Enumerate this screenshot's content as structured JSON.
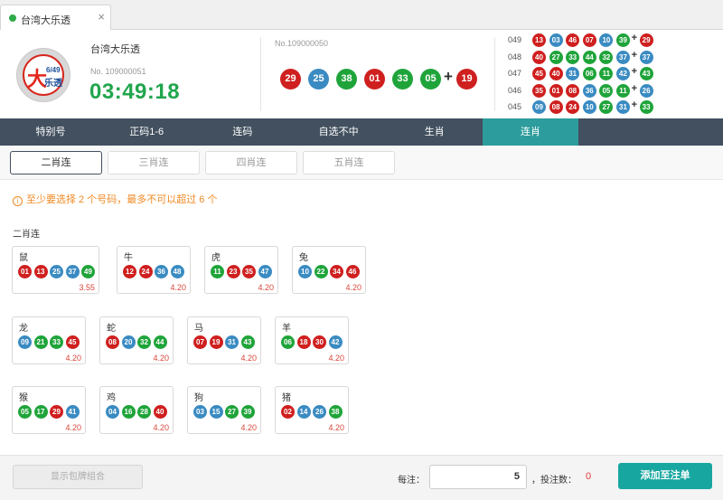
{
  "colors": {
    "red": "#cf1f1f",
    "blue": "#3a8bc2",
    "green": "#1fa43a",
    "accent": "#2d9c9c",
    "nav_bg": "#42505f"
  },
  "tab": {
    "title": "台湾大乐透",
    "close": "×"
  },
  "header": {
    "game_name": "台湾大乐透",
    "issue_label": "No. 109000051",
    "countdown": "03:49:18",
    "logo_big": "大",
    "logo_sm": "6/49",
    "logo_sm2": "乐透",
    "last_issue_label": "No.109000050",
    "last_draw": {
      "balls": [
        {
          "n": "29",
          "c": "red"
        },
        {
          "n": "25",
          "c": "blue"
        },
        {
          "n": "38",
          "c": "green"
        },
        {
          "n": "01",
          "c": "red"
        },
        {
          "n": "33",
          "c": "green"
        },
        {
          "n": "05",
          "c": "green"
        }
      ],
      "special": {
        "n": "19",
        "c": "red"
      }
    },
    "history": [
      {
        "issue": "049",
        "balls": [
          {
            "n": "13",
            "c": "red"
          },
          {
            "n": "03",
            "c": "blue"
          },
          {
            "n": "46",
            "c": "red"
          },
          {
            "n": "07",
            "c": "red"
          },
          {
            "n": "10",
            "c": "blue"
          },
          {
            "n": "39",
            "c": "green"
          }
        ],
        "special": {
          "n": "29",
          "c": "red"
        }
      },
      {
        "issue": "048",
        "balls": [
          {
            "n": "40",
            "c": "red"
          },
          {
            "n": "27",
            "c": "green"
          },
          {
            "n": "33",
            "c": "green"
          },
          {
            "n": "44",
            "c": "green"
          },
          {
            "n": "32",
            "c": "green"
          },
          {
            "n": "37",
            "c": "blue"
          }
        ],
        "special": {
          "n": "37",
          "c": "blue"
        }
      },
      {
        "issue": "047",
        "balls": [
          {
            "n": "45",
            "c": "red"
          },
          {
            "n": "40",
            "c": "red"
          },
          {
            "n": "31",
            "c": "blue"
          },
          {
            "n": "06",
            "c": "green"
          },
          {
            "n": "11",
            "c": "green"
          },
          {
            "n": "42",
            "c": "blue"
          }
        ],
        "special": {
          "n": "43",
          "c": "green"
        }
      },
      {
        "issue": "046",
        "balls": [
          {
            "n": "35",
            "c": "red"
          },
          {
            "n": "01",
            "c": "red"
          },
          {
            "n": "08",
            "c": "red"
          },
          {
            "n": "36",
            "c": "blue"
          },
          {
            "n": "05",
            "c": "green"
          },
          {
            "n": "11",
            "c": "green"
          }
        ],
        "special": {
          "n": "26",
          "c": "blue"
        }
      },
      {
        "issue": "045",
        "balls": [
          {
            "n": "09",
            "c": "blue"
          },
          {
            "n": "08",
            "c": "red"
          },
          {
            "n": "24",
            "c": "red"
          },
          {
            "n": "10",
            "c": "blue"
          },
          {
            "n": "27",
            "c": "green"
          },
          {
            "n": "31",
            "c": "blue"
          }
        ],
        "special": {
          "n": "33",
          "c": "green"
        }
      }
    ],
    "plus": "+"
  },
  "nav": {
    "items": [
      {
        "label": "特别号",
        "active": false
      },
      {
        "label": "正码1-6",
        "active": false
      },
      {
        "label": "连码",
        "active": false
      },
      {
        "label": "自选不中",
        "active": false
      },
      {
        "label": "生肖",
        "active": false
      },
      {
        "label": "连肖",
        "active": true
      }
    ]
  },
  "subtabs": {
    "items": [
      {
        "label": "二肖连",
        "active": true
      },
      {
        "label": "三肖连",
        "active": false
      },
      {
        "label": "四肖连",
        "active": false
      },
      {
        "label": "五肖连",
        "active": false
      }
    ]
  },
  "notice": {
    "icon": "i",
    "text": "至少要选择 2 个号码，最多不可以超过 6 个"
  },
  "section_title": "二肖连",
  "zodiacs": [
    {
      "name": "鼠",
      "odds": "3.55",
      "balls": [
        {
          "n": "01",
          "c": "red"
        },
        {
          "n": "13",
          "c": "red"
        },
        {
          "n": "25",
          "c": "blue"
        },
        {
          "n": "37",
          "c": "blue"
        },
        {
          "n": "49",
          "c": "green"
        }
      ]
    },
    {
      "name": "牛",
      "odds": "4.20",
      "balls": [
        {
          "n": "12",
          "c": "red"
        },
        {
          "n": "24",
          "c": "red"
        },
        {
          "n": "36",
          "c": "blue"
        },
        {
          "n": "48",
          "c": "blue"
        }
      ]
    },
    {
      "name": "虎",
      "odds": "4.20",
      "balls": [
        {
          "n": "11",
          "c": "green"
        },
        {
          "n": "23",
          "c": "red"
        },
        {
          "n": "35",
          "c": "red"
        },
        {
          "n": "47",
          "c": "blue"
        }
      ]
    },
    {
      "name": "兔",
      "odds": "4.20",
      "balls": [
        {
          "n": "10",
          "c": "blue"
        },
        {
          "n": "22",
          "c": "green"
        },
        {
          "n": "34",
          "c": "red"
        },
        {
          "n": "46",
          "c": "red"
        }
      ]
    },
    {
      "name": "龙",
      "odds": "4.20",
      "balls": [
        {
          "n": "09",
          "c": "blue"
        },
        {
          "n": "21",
          "c": "green"
        },
        {
          "n": "33",
          "c": "green"
        },
        {
          "n": "45",
          "c": "red"
        }
      ]
    },
    {
      "name": "蛇",
      "odds": "4.20",
      "balls": [
        {
          "n": "08",
          "c": "red"
        },
        {
          "n": "20",
          "c": "blue"
        },
        {
          "n": "32",
          "c": "green"
        },
        {
          "n": "44",
          "c": "green"
        }
      ]
    },
    {
      "name": "马",
      "odds": "4.20",
      "balls": [
        {
          "n": "07",
          "c": "red"
        },
        {
          "n": "19",
          "c": "red"
        },
        {
          "n": "31",
          "c": "blue"
        },
        {
          "n": "43",
          "c": "green"
        }
      ]
    },
    {
      "name": "羊",
      "odds": "4.20",
      "balls": [
        {
          "n": "06",
          "c": "green"
        },
        {
          "n": "18",
          "c": "red"
        },
        {
          "n": "30",
          "c": "red"
        },
        {
          "n": "42",
          "c": "blue"
        }
      ]
    },
    {
      "name": "猴",
      "odds": "4.20",
      "balls": [
        {
          "n": "05",
          "c": "green"
        },
        {
          "n": "17",
          "c": "green"
        },
        {
          "n": "29",
          "c": "red"
        },
        {
          "n": "41",
          "c": "blue"
        }
      ]
    },
    {
      "name": "鸡",
      "odds": "4.20",
      "balls": [
        {
          "n": "04",
          "c": "blue"
        },
        {
          "n": "16",
          "c": "green"
        },
        {
          "n": "28",
          "c": "green"
        },
        {
          "n": "40",
          "c": "red"
        }
      ]
    },
    {
      "name": "狗",
      "odds": "4.20",
      "balls": [
        {
          "n": "03",
          "c": "blue"
        },
        {
          "n": "15",
          "c": "blue"
        },
        {
          "n": "27",
          "c": "green"
        },
        {
          "n": "39",
          "c": "green"
        }
      ]
    },
    {
      "name": "猪",
      "odds": "4.20",
      "balls": [
        {
          "n": "02",
          "c": "red"
        },
        {
          "n": "14",
          "c": "blue"
        },
        {
          "n": "26",
          "c": "blue"
        },
        {
          "n": "38",
          "c": "green"
        }
      ]
    }
  ],
  "footer": {
    "show_label": "显示包牌组合",
    "per_bet_label": "每注：",
    "amount": "5",
    "count_label": "，投注数：",
    "count": "0",
    "add_label": "添加至注单"
  }
}
